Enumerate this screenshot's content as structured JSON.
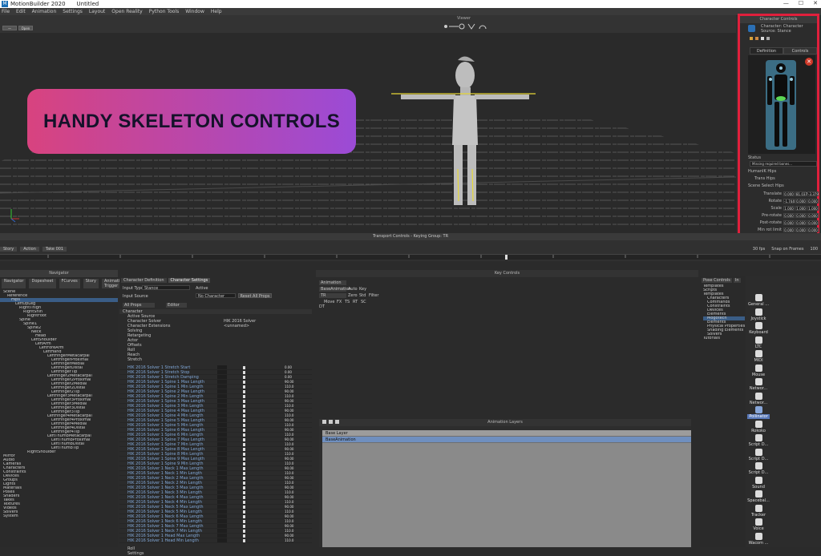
{
  "window": {
    "app_title": "MotionBuilder 2020",
    "doc_title": "Untitled",
    "logo_glyph": "M"
  },
  "window_controls": {
    "minimize": "—",
    "maximize": "☐",
    "close": "✕"
  },
  "menu": [
    "File",
    "Edit",
    "Animation",
    "Settings",
    "Layout",
    "Open Reality",
    "Python Tools",
    "Window",
    "Help"
  ],
  "viewer": {
    "label": "Viewer",
    "left_btn1": "—",
    "left_btn2": "Open"
  },
  "overlay": {
    "text": "HANDY SKELETON CONTROLS"
  },
  "character_controls": {
    "title": "Character Controls",
    "character_line": "Character: Character",
    "source_line": "Source: Stance",
    "tabs": [
      "Definition",
      "Controls"
    ],
    "close_glyph": "✕",
    "status_label": "Status",
    "status_value": "Missing required bones...",
    "humanik_label": "HumanIK Hips",
    "trans_label": "Trans Hips",
    "scene_label": "Scene Select Hips",
    "fields": [
      {
        "label": "Translate",
        "values": [
          "0.000",
          "81.037",
          "-3.379"
        ]
      },
      {
        "label": "Rotate",
        "values": [
          "-1.744",
          "0.000",
          "0.000"
        ]
      },
      {
        "label": "Scale",
        "values": [
          "1.000",
          "1.000",
          "1.000"
        ]
      },
      {
        "label": "Pre-rotate",
        "values": [
          "0.000",
          "0.000",
          "0.000"
        ]
      },
      {
        "label": "Post-rotate",
        "values": [
          "0.000",
          "0.000",
          "0.000"
        ]
      },
      {
        "label": "Min rot limit",
        "values": [
          "0.000",
          "0.000",
          "0.000"
        ]
      }
    ]
  },
  "transport": {
    "label": "Transport Controls - Keying Group: TR"
  },
  "timeline": {
    "tabs": [
      "Story",
      "Action",
      "Take 001"
    ],
    "fps": "30 fps",
    "snap": "Snap on Frames",
    "end_frame": "100"
  },
  "navigator": {
    "title": "Navigator",
    "tabs": [
      "Navigator",
      "Dopesheet",
      "FCurves",
      "Story",
      "Animation Trigger"
    ],
    "tree": [
      "Scene",
      "Reference",
      "Hips",
      "LeftUpLeg",
      "RightThigh",
      "RightShin",
      "RightFoot",
      "Spine",
      "Spine1",
      "Spine2",
      "Neck",
      "Head",
      "LeftShoulder",
      "LeftArm",
      "LeftForeArm",
      "LeftHand",
      "LeftFingerMetacarpal",
      "LeftFingerProximal",
      "LeftFingerMedial",
      "LeftFingerDistal",
      "LeftFingerTip",
      "LeftFinger2Metacarpal",
      "LeftFinger2Proximal",
      "LeftFinger2Medial",
      "LeftFinger2Distal",
      "LeftFinger2Tip",
      "LeftFinger3Metacarpal",
      "LeftFinger3Proximal",
      "LeftFinger3Medial",
      "LeftFinger3Distal",
      "LeftFinger3Tip",
      "LeftFinger4Metacarpal",
      "LeftFinger4Proximal",
      "LeftFinger4Medial",
      "LeftFinger4Distal",
      "LeftFinger4Tip",
      "LeftThumbMetacarpal",
      "LeftThumbProximal",
      "LeftThumbDistal",
      "LeftThumbTip",
      "RightShoulder",
      "Mirror",
      "Audio",
      "Cameras",
      "Characters",
      "Constraints",
      "Devices",
      "Groups",
      "Lights",
      "Materials",
      "Poses",
      "Shaders",
      "Takes",
      "Textures",
      "Videos",
      "Solvers",
      "System"
    ]
  },
  "character_settings": {
    "tabs": [
      "Character Definition",
      "Character Settings"
    ],
    "input_type_label": "Input Type",
    "input_type_value": "Stance",
    "active_label": "Active",
    "input_source_label": "Input Source",
    "input_source_value": "No Character",
    "reset_label": "Reset All Props",
    "filter_label": "All Props",
    "editor_label": "Editor",
    "section": "Character",
    "props": [
      {
        "name": "Active Source",
        "value": ""
      },
      {
        "name": "Character Solver",
        "value": "HIK 2016 Solver"
      },
      {
        "name": "Character Extensions",
        "value": "<unnamed>"
      },
      {
        "name": "Solving",
        "value": ""
      },
      {
        "name": "Retargeting",
        "value": ""
      },
      {
        "name": "Actor",
        "value": ""
      },
      {
        "name": "Offsets",
        "value": ""
      },
      {
        "name": "Roll",
        "value": ""
      },
      {
        "name": "Reach",
        "value": ""
      },
      {
        "name": "Stretch",
        "value": ""
      }
    ],
    "solver_rows": [
      {
        "name": "HIK 2016 Solver 1 Stretch Start",
        "num": "0.00"
      },
      {
        "name": "HIK 2016 Solver 1 Stretch Stop",
        "num": "0.00"
      },
      {
        "name": "HIK 2016 Solver 1 Stretch Damping",
        "num": "0.00"
      },
      {
        "name": "HIK 2016 Solver 1 Spine 1 Max Length",
        "num": "90.00"
      },
      {
        "name": "HIK 2016 Solver 1 Spine 1 Min Length",
        "num": "110.0"
      },
      {
        "name": "HIK 2016 Solver 1 Spine 2 Max Length",
        "num": "90.00"
      },
      {
        "name": "HIK 2016 Solver 1 Spine 2 Min Length",
        "num": "110.0"
      },
      {
        "name": "HIK 2016 Solver 1 Spine 3 Max Length",
        "num": "90.00"
      },
      {
        "name": "HIK 2016 Solver 1 Spine 3 Min Length",
        "num": "110.0"
      },
      {
        "name": "HIK 2016 Solver 1 Spine 4 Max Length",
        "num": "90.00"
      },
      {
        "name": "HIK 2016 Solver 1 Spine 4 Min Length",
        "num": "110.0"
      },
      {
        "name": "HIK 2016 Solver 1 Spine 5 Max Length",
        "num": "90.00"
      },
      {
        "name": "HIK 2016 Solver 1 Spine 5 Min Length",
        "num": "110.0"
      },
      {
        "name": "HIK 2016 Solver 1 Spine 6 Max Length",
        "num": "90.00"
      },
      {
        "name": "HIK 2016 Solver 1 Spine 6 Min Length",
        "num": "110.0"
      },
      {
        "name": "HIK 2016 Solver 1 Spine 7 Max Length",
        "num": "90.00"
      },
      {
        "name": "HIK 2016 Solver 1 Spine 7 Min Length",
        "num": "110.0"
      },
      {
        "name": "HIK 2016 Solver 1 Spine 8 Max Length",
        "num": "90.00"
      },
      {
        "name": "HIK 2016 Solver 1 Spine 8 Min Length",
        "num": "110.0"
      },
      {
        "name": "HIK 2016 Solver 1 Spine 9 Max Length",
        "num": "90.00"
      },
      {
        "name": "HIK 2016 Solver 1 Spine 9 Min Length",
        "num": "110.0"
      },
      {
        "name": "HIK 2016 Solver 1 Neck 1 Max Length",
        "num": "90.00"
      },
      {
        "name": "HIK 2016 Solver 1 Neck 1 Min Length",
        "num": "110.0"
      },
      {
        "name": "HIK 2016 Solver 1 Neck 2 Max Length",
        "num": "90.00"
      },
      {
        "name": "HIK 2016 Solver 1 Neck 2 Min Length",
        "num": "110.0"
      },
      {
        "name": "HIK 2016 Solver 1 Neck 3 Max Length",
        "num": "90.00"
      },
      {
        "name": "HIK 2016 Solver 1 Neck 3 Min Length",
        "num": "110.0"
      },
      {
        "name": "HIK 2016 Solver 1 Neck 4 Max Length",
        "num": "90.00"
      },
      {
        "name": "HIK 2016 Solver 1 Neck 4 Min Length",
        "num": "110.0"
      },
      {
        "name": "HIK 2016 Solver 1 Neck 5 Max Length",
        "num": "90.00"
      },
      {
        "name": "HIK 2016 Solver 1 Neck 5 Min Length",
        "num": "110.0"
      },
      {
        "name": "HIK 2016 Solver 1 Neck 6 Max Length",
        "num": "90.00"
      },
      {
        "name": "HIK 2016 Solver 1 Neck 6 Min Length",
        "num": "110.0"
      },
      {
        "name": "HIK 2016 Solver 1 Neck 7 Max Length",
        "num": "90.00"
      },
      {
        "name": "HIK 2016 Solver 1 Neck 7 Min Length",
        "num": "110.0"
      },
      {
        "name": "HIK 2016 Solver 1 Head Max Length",
        "num": "90.00"
      },
      {
        "name": "HIK 2016 Solver 1 Head Min Length",
        "num": "110.0"
      }
    ],
    "footer": [
      "Roll",
      "Settings"
    ]
  },
  "key_controls": {
    "title": "Key Controls",
    "animation_label": "Animation",
    "base_label": "BaseAnimation",
    "auto_label": "Auto",
    "key_label": "Key",
    "tr_label": "TR",
    "zero_label": "Zero",
    "std_label": "Std",
    "filter_label": "Filter",
    "move_label": "Move",
    "fx_label": "FX",
    "ts_label": "TS",
    "rt_label": "RT",
    "sc_label": "SC",
    "dt_label": "DT"
  },
  "animation_layers": {
    "title": "Animation Layers",
    "layers": [
      "Base Layer",
      "BaseAnimation"
    ]
  },
  "pose_controls": {
    "tabs": [
      "Pose Controls",
      "In"
    ],
    "tree": [
      "Templates",
      "Scripts",
      "Templates",
      "Characters",
      "Commands",
      "Constraints",
      "Devices",
      "Elements",
      "Mogotech",
      "Elements",
      "Physical Properties",
      "Shading Elements",
      "Solvers",
      "Tutorials"
    ]
  },
  "assets": [
    {
      "label": "General ...",
      "selected": false
    },
    {
      "label": "Joystick",
      "selected": false
    },
    {
      "label": "Keyboard",
      "selected": false
    },
    {
      "label": "LTC",
      "selected": false
    },
    {
      "label": "MIDI",
      "selected": false
    },
    {
      "label": "Mouse",
      "selected": false
    },
    {
      "label": "Networ...",
      "selected": false
    },
    {
      "label": "Networ...",
      "selected": false
    },
    {
      "label": "Pollinator",
      "selected": true
    },
    {
      "label": "Rokoko",
      "selected": false
    },
    {
      "label": "Script D...",
      "selected": false
    },
    {
      "label": "Script D...",
      "selected": false
    },
    {
      "label": "Script D...",
      "selected": false
    },
    {
      "label": "Sound",
      "selected": false
    },
    {
      "label": "Spacebal...",
      "selected": false
    },
    {
      "label": "Tracker",
      "selected": false
    },
    {
      "label": "Voice",
      "selected": false
    },
    {
      "label": "Wacom ...",
      "selected": false
    }
  ],
  "colors": {
    "badge_start": "#d8437f",
    "badge_end": "#9b4bd6",
    "highlight": "#e0203c",
    "selection": "#3a5d86"
  }
}
